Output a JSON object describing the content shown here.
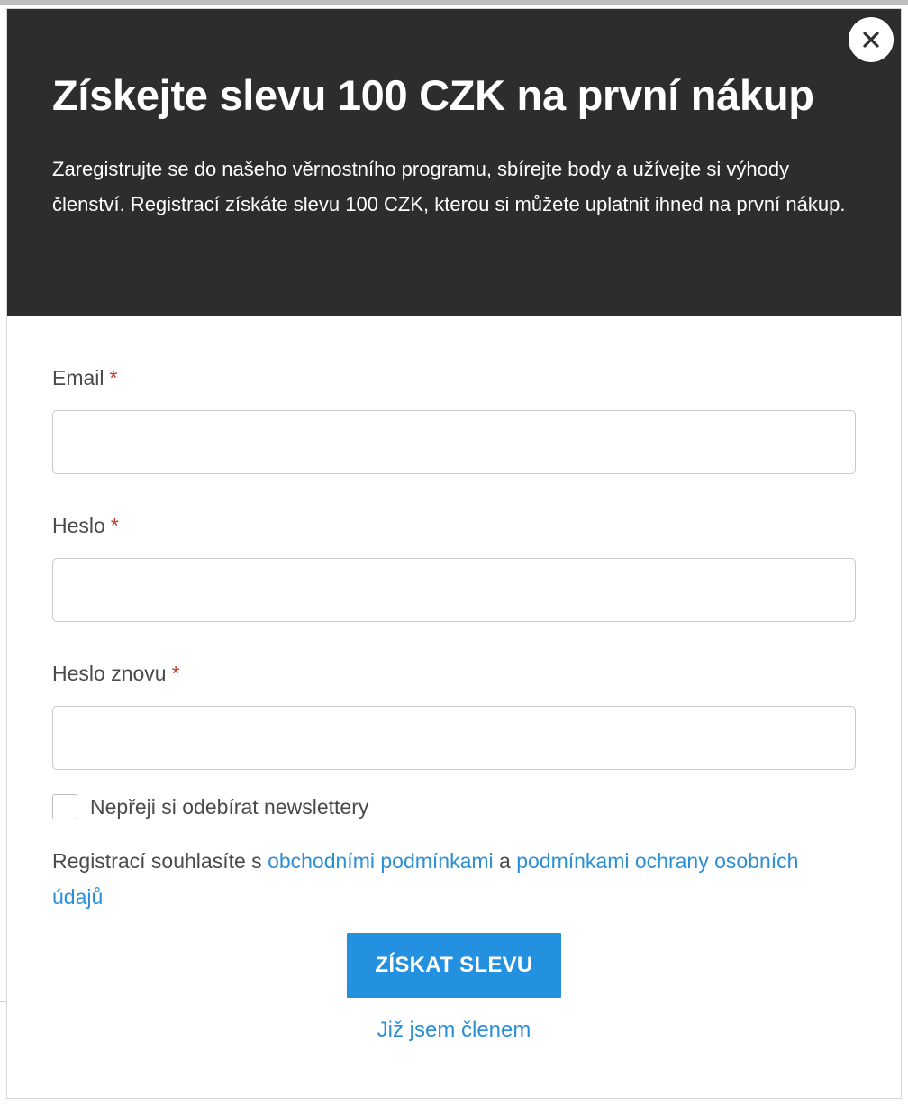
{
  "modal": {
    "title": "Získejte slevu 100 CZK na první nákup",
    "intro": "Zaregistrujte se do našeho věrnostního programu, sbírejte body a užívejte si výhody členství. Registrací získáte slevu 100 CZK, kterou si můžete uplatnit ihned na první nákup.",
    "close_icon": "close-icon"
  },
  "form": {
    "email": {
      "label": "Email",
      "required_mark": "*",
      "value": "",
      "placeholder": ""
    },
    "password": {
      "label": "Heslo",
      "required_mark": "*",
      "value": "",
      "placeholder": ""
    },
    "password_confirm": {
      "label": "Heslo znovu",
      "required_mark": "*",
      "value": "",
      "placeholder": ""
    },
    "newsletter_optout": {
      "label": "Nepřeji si odebírat newslettery",
      "checked": false
    }
  },
  "consent": {
    "prefix": "Registrací souhlasíte s ",
    "terms_link": "obchodními podmínkami",
    "conjunction": " a ",
    "privacy_link": "podmínkami ochrany osobních údajů"
  },
  "actions": {
    "submit_label": "ZÍSKAT SLEVU",
    "member_link": "Již jsem členem"
  },
  "colors": {
    "header_bg": "#2d2d2d",
    "accent": "#2391e0",
    "link": "#2b8fd6",
    "required": "#c0392b"
  }
}
